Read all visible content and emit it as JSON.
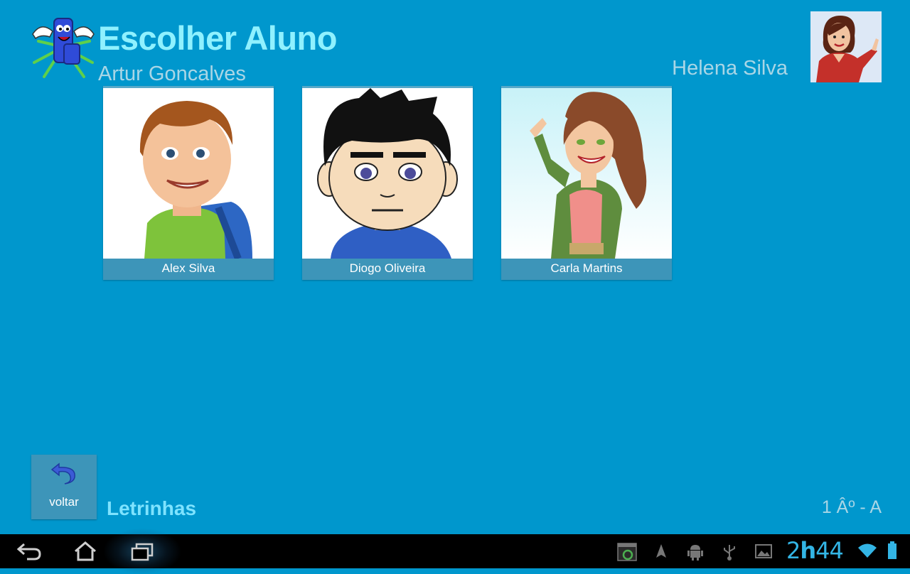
{
  "header": {
    "title": "Escolher Aluno",
    "subtitle": "Artur Goncalves",
    "logo_icon": "letrinhas-mascot-logo"
  },
  "teacher": {
    "name": "Helena Silva",
    "avatar_icon": "teacher-avatar"
  },
  "students": [
    {
      "name": "Alex Silva",
      "avatar_icon": "boy-with-backpack-avatar"
    },
    {
      "name": "Diogo Oliveira",
      "avatar_icon": "boy-cartoon-avatar"
    },
    {
      "name": "Carla Martins",
      "avatar_icon": "girl-waving-avatar"
    }
  ],
  "footer": {
    "back_label": "voltar",
    "back_icon": "undo-arrow-icon",
    "app_name": "Letrinhas",
    "class_label": "1 Âº - A"
  },
  "system_bar": {
    "clock_hours": "2",
    "clock_sep": "h",
    "clock_minutes": "44",
    "nav_icons": [
      "back-icon",
      "home-icon",
      "recent-apps-icon"
    ],
    "status_icons": [
      "screenshot-icon",
      "location-icon",
      "android-debug-icon",
      "usb-icon",
      "gallery-icon",
      "wifi-icon",
      "battery-icon"
    ]
  },
  "colors": {
    "background": "#0097cd",
    "title": "#8ff1ff",
    "card": "#3d95b9",
    "accent": "#33b5e5"
  }
}
